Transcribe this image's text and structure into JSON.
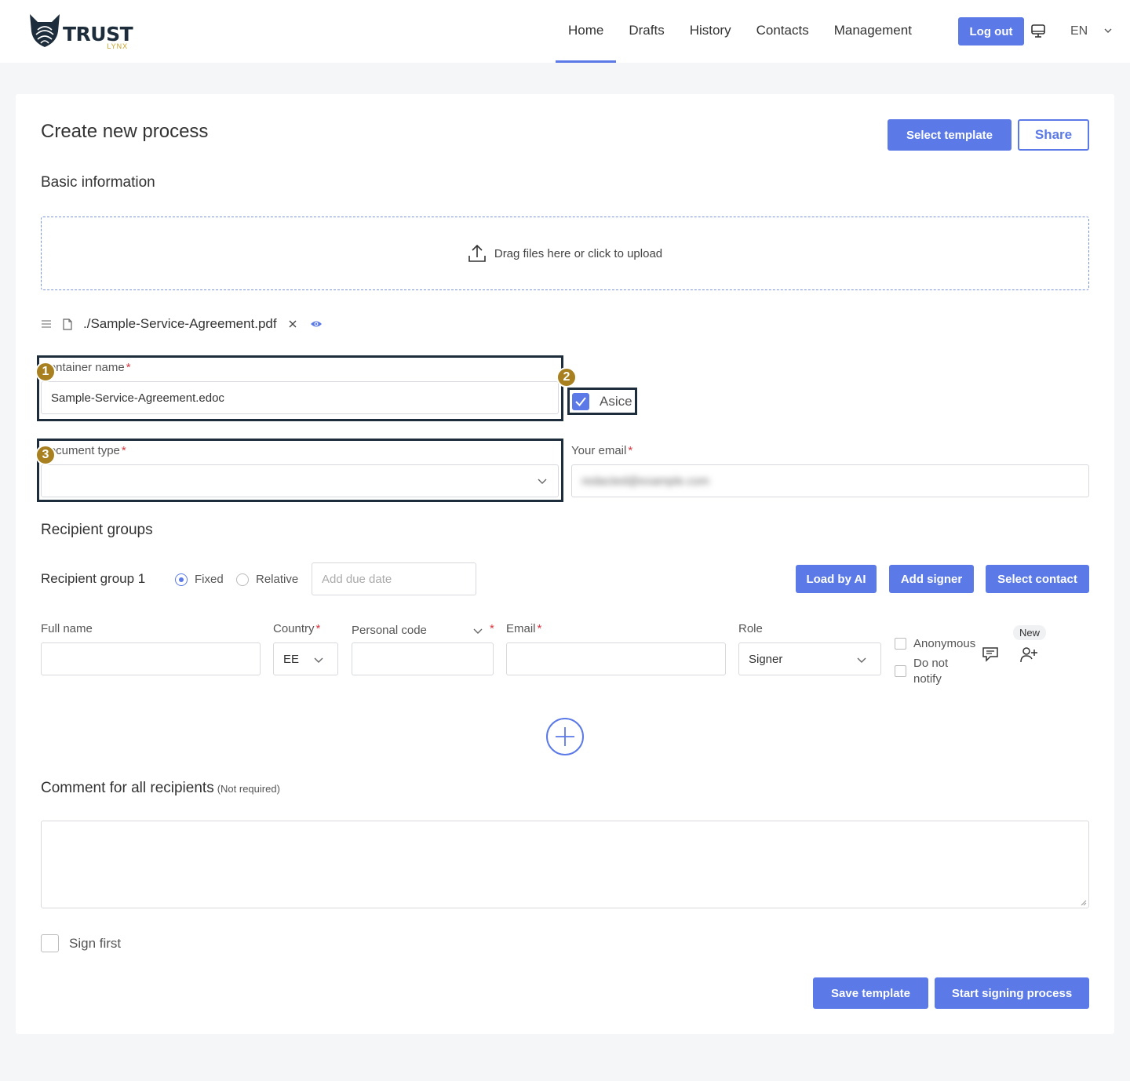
{
  "header": {
    "brand": "TRUST",
    "brand_sub": "LYNX",
    "nav": [
      {
        "label": "Home",
        "active": true
      },
      {
        "label": "Drafts",
        "active": false
      },
      {
        "label": "History",
        "active": false
      },
      {
        "label": "Contacts",
        "active": false
      },
      {
        "label": "Management",
        "active": false
      }
    ],
    "logout_label": "Log out",
    "language": "EN"
  },
  "page": {
    "title": "Create new process",
    "select_template_label": "Select template",
    "share_label": "Share"
  },
  "basic": {
    "heading": "Basic information",
    "upload_text": "Drag files here or click to upload",
    "file_name": "./Sample-Service-Agreement.pdf",
    "container_label": "Container name",
    "container_value": "Sample-Service-Agreement.edoc",
    "asice_label": "Asice",
    "asice_checked": true,
    "doc_type_label": "Document type",
    "doc_type_value": "",
    "email_label": "Your email",
    "email_value": "redacted@example.com",
    "required_mark": "*"
  },
  "annotations": [
    "1",
    "2",
    "3"
  ],
  "recipients": {
    "heading": "Recipient groups",
    "group_label": "Recipient group 1",
    "fixed_label": "Fixed",
    "relative_label": "Relative",
    "due_date_placeholder": "Add due date",
    "load_ai_label": "Load by AI",
    "add_signer_label": "Add signer",
    "select_contact_label": "Select contact",
    "columns": {
      "full_name": "Full name",
      "country": "Country",
      "personal_code": "Personal code",
      "email": "Email",
      "role": "Role"
    },
    "row": {
      "full_name": "",
      "country": "EE",
      "personal_code": "",
      "email": "",
      "role": "Signer",
      "anonymous_label": "Anonymous",
      "do_not_notify_label": "Do not notify",
      "new_badge": "New"
    }
  },
  "comment": {
    "heading": "Comment for all recipients",
    "note": "(Not required)",
    "value": ""
  },
  "footer": {
    "sign_first_label": "Sign first",
    "save_template_label": "Save template",
    "start_label": "Start signing process"
  },
  "colors": {
    "primary": "#5b7ae8",
    "badge": "#a8801f",
    "highlight": "#1e2d3b",
    "required": "#d9363e"
  }
}
